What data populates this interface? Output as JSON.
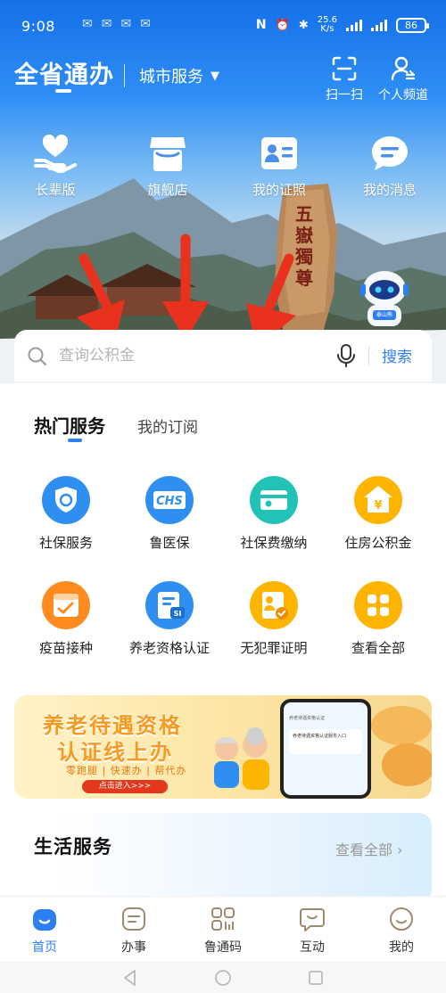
{
  "status_bar": {
    "time": "9:08",
    "network_speed_value": "25.6",
    "network_speed_unit": "K/s",
    "battery": "86"
  },
  "header": {
    "app_title": "全省通办",
    "city_service": "城市服务",
    "scan_label": "扫一扫",
    "profile_label": "个人频道"
  },
  "quick_entries": [
    {
      "label": "长辈版",
      "icon": "heart-hand-icon"
    },
    {
      "label": "旗舰店",
      "icon": "store-icon"
    },
    {
      "label": "我的证照",
      "icon": "id-card-icon"
    },
    {
      "label": "我的消息",
      "icon": "message-icon"
    }
  ],
  "hero": {
    "rock_inscription": "五嶽獨尊",
    "mascot_label": "泰山熊"
  },
  "search": {
    "placeholder": "查询公积金",
    "button": "搜索"
  },
  "tabs": {
    "hot": "热门服务",
    "subscriptions": "我的订阅"
  },
  "services": [
    {
      "label": "社保服务",
      "icon": "social-security-icon",
      "color": "#2f8ff0"
    },
    {
      "label": "鲁医保",
      "icon": "chs-medical-icon",
      "icon_text": "CHS",
      "color": "#2f8ff0"
    },
    {
      "label": "社保费缴纳",
      "icon": "payment-icon",
      "color": "#22c3b6"
    },
    {
      "label": "住房公积金",
      "icon": "housing-fund-icon",
      "icon_text": "¥",
      "color": "#ffb400"
    },
    {
      "label": "疫苗接种",
      "icon": "vaccine-calendar-icon",
      "color": "#ff8a1e"
    },
    {
      "label": "养老资格认证",
      "icon": "pension-cert-icon",
      "icon_text": "SI",
      "color": "#2f8ff0"
    },
    {
      "label": "无犯罪证明",
      "icon": "no-crime-cert-icon",
      "color": "#ffb400"
    },
    {
      "label": "查看全部",
      "icon": "grid-all-icon",
      "color": "#ffb400"
    }
  ],
  "banner": {
    "line1": "养老待遇资格",
    "line2": "认证线上办",
    "tagline": "零跑腿 | 快速办 | 帮代办",
    "cta": "点击进入>>>",
    "phone_header": "养老待遇资格认证",
    "phone_card": "养老待遇资格认证服务入口"
  },
  "life_services": {
    "title": "生活服务",
    "more": "查看全部 ›"
  },
  "bottom_nav": [
    {
      "label": "首页",
      "icon": "home-icon",
      "active": true
    },
    {
      "label": "办事",
      "icon": "affairs-icon",
      "active": false
    },
    {
      "label": "鲁通码",
      "icon": "qr-code-icon",
      "active": false
    },
    {
      "label": "互动",
      "icon": "interaction-icon",
      "active": false
    },
    {
      "label": "我的",
      "icon": "profile-icon",
      "active": false
    }
  ],
  "colors": {
    "primary": "#2d7ef0",
    "hero_top": "#1470e8",
    "annotation_red": "#e8321e"
  }
}
